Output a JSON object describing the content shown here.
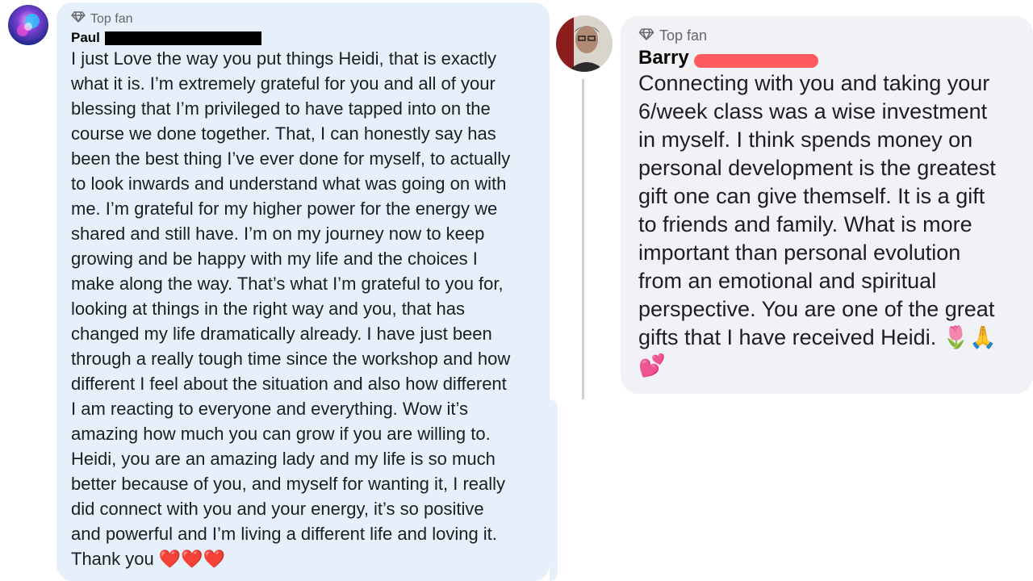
{
  "comments": [
    {
      "badge": "Top fan",
      "author": "Paul",
      "avatar_icon": "profile-photo",
      "text": "I just Love the way you put things Heidi, that is exactly\nwhat it is. I’m extremely grateful for you and all of your\nblessing that I’m privileged to have tapped into on the\ncourse we done together. That, I can honestly say has\nbeen the best thing I’ve ever done for myself, to actually\nto look inwards and understand what was going on with\nme. I’m grateful for my higher power for the energy we\nshared and still have. I’m on my journey now to keep\ngrowing and be happy with my life and the choices I\nmake along the way. That’s what I’m grateful to you for,\nlooking at things in the right way and you, that has\nchanged my life dramatically already. I have just been\nthrough a really tough time since the workshop and how\ndifferent I feel about the situation and also how different\nI am reacting to everyone and everything. Wow it’s\namazing how much you can grow if you are willing to.\nHeidi, you are an amazing lady and my life is so much\nbetter because of you, and myself for wanting it, I really\ndid connect with you and your energy, it’s so positive\nand powerful and I’m living a different life and loving it.\nThank you",
      "emojis": "❤️❤️❤️",
      "bubble_color": "#e6f0fb"
    },
    {
      "badge": "Top fan",
      "author": "Barry",
      "avatar_icon": "profile-photo",
      "text": "Connecting with you and taking your\n6/week class was a wise investment\nin myself. I think spends money on\npersonal development is the greatest\ngift one can give themself. It is a gift\nto friends and family. What is more\nimportant than personal evolution\nfrom an emotional and spiritual\nperspective. You are one of the great\ngifts that I have received Heidi.",
      "emojis": "🌷🙏",
      "emojis_line2": "💕",
      "bubble_color": "#f0f2f5"
    }
  ]
}
